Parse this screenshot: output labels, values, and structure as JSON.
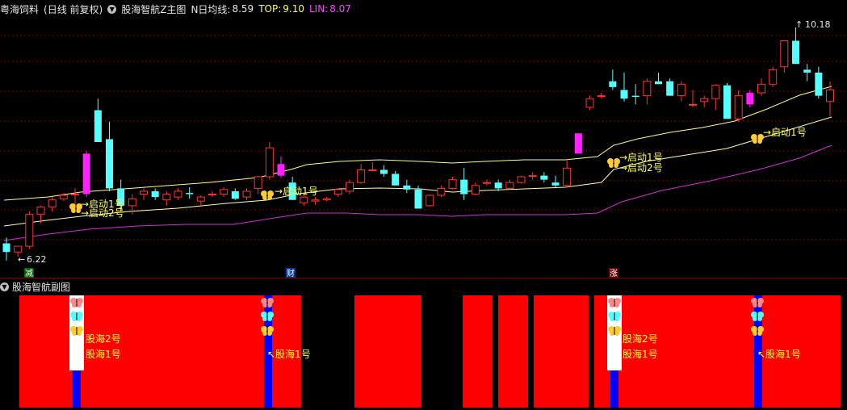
{
  "header": {
    "stock_name": "粤海饲料",
    "period": "(日线 前复权)",
    "indicator_name": "股海智航Z主图",
    "n_avg_label": "N日均线:",
    "n_avg_value": "8.59",
    "top_label": "TOP:",
    "top_value": "9.10",
    "lin_label": "LIN:",
    "lin_value": "8.07",
    "dropdown_icon": "chevron-down-icon"
  },
  "main_chart": {
    "low_price_label": "6.22",
    "high_price_label": "10.18",
    "markers": [
      "减",
      "财",
      "涨"
    ],
    "start_labels": {
      "one": "启动1号",
      "two": "启动2号"
    },
    "colors": {
      "up": "#ff3333",
      "down": "#55ffff",
      "signal": "#ff22ff",
      "mid": "#ffff88",
      "lower": "#ffffaa",
      "lin": "#cc33cc",
      "grid": "#800000"
    }
  },
  "sub_chart": {
    "title": "股海智航副图",
    "label_2": "股海2号",
    "label_1": "股海1号",
    "colors": {
      "fill": "#ff0000",
      "bar": "#0000ff",
      "white": "#ffffff"
    }
  },
  "chart_data": {
    "type": "candlestick",
    "title": "股海智航Z主图",
    "x": [
      1,
      2,
      3,
      4,
      5,
      6,
      7,
      8,
      9,
      10,
      11,
      12,
      13,
      14,
      15,
      16,
      17,
      18,
      19,
      20,
      21,
      22,
      23,
      24,
      25,
      26,
      27,
      28,
      29,
      30,
      31,
      32,
      33,
      34,
      35,
      36,
      37,
      38,
      39,
      40,
      41,
      42,
      43,
      44,
      45,
      46,
      47,
      48,
      49,
      50,
      51,
      52,
      53,
      54,
      55,
      56,
      57,
      58,
      59,
      60,
      61,
      62,
      63,
      64,
      65,
      66,
      67,
      68,
      69,
      70,
      71,
      72,
      73
    ],
    "price_range": [
      6.0,
      10.4
    ],
    "annotations": {
      "low": 6.22,
      "high": 10.18
    },
    "series": [
      {
        "name": "N日均线",
        "value_last": 8.59
      },
      {
        "name": "TOP",
        "value_last": 9.1
      },
      {
        "name": "LIN",
        "value_last": 8.07
      }
    ]
  }
}
